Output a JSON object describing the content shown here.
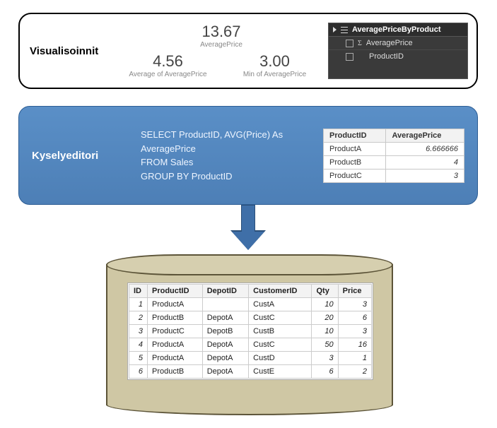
{
  "viz": {
    "title": "Visualisoinnit",
    "metrics": {
      "m1": {
        "value": "13.67",
        "label": "AveragePrice"
      },
      "m2": {
        "value": "4.56",
        "label": "Average of AveragePrice"
      },
      "m3": {
        "value": "3.00",
        "label": "Min of AveragePrice"
      }
    },
    "fields": {
      "table_name": "AveragePriceByProduct",
      "items": [
        {
          "name": "AveragePrice",
          "sigma": true
        },
        {
          "name": "ProductID",
          "sigma": false
        }
      ]
    }
  },
  "query": {
    "title": "Kyselyeditori",
    "sql": {
      "l1": "SELECT ProductID, AVG(Price) As",
      "l2": "AveragePrice",
      "l3": "FROM Sales",
      "l4": "GROUP BY ProductID"
    },
    "result": {
      "cols": {
        "c1": "ProductID",
        "c2": "AveragePrice"
      },
      "rows": [
        {
          "c1": "ProductA",
          "c2": "6.666666"
        },
        {
          "c1": "ProductB",
          "c2": "4"
        },
        {
          "c1": "ProductC",
          "c2": "3"
        }
      ]
    }
  },
  "db": {
    "cols": {
      "c0": "ID",
      "c1": "ProductID",
      "c2": "DepotID",
      "c3": "CustomerID",
      "c4": "Qty",
      "c5": "Price"
    },
    "rows": [
      {
        "c0": "1",
        "c1": "ProductA",
        "c2": "",
        "c3": "CustA",
        "c4": "10",
        "c5": "3"
      },
      {
        "c0": "2",
        "c1": "ProductB",
        "c2": "DepotA",
        "c3": "CustC",
        "c4": "20",
        "c5": "6"
      },
      {
        "c0": "3",
        "c1": "ProductC",
        "c2": "DepotB",
        "c3": "CustB",
        "c4": "10",
        "c5": "3"
      },
      {
        "c0": "4",
        "c1": "ProductA",
        "c2": "DepotA",
        "c3": "CustC",
        "c4": "50",
        "c5": "16"
      },
      {
        "c0": "5",
        "c1": "ProductA",
        "c2": "DepotA",
        "c3": "CustD",
        "c4": "3",
        "c5": "1"
      },
      {
        "c0": "6",
        "c1": "ProductB",
        "c2": "DepotA",
        "c3": "CustE",
        "c4": "6",
        "c5": "2"
      }
    ]
  }
}
